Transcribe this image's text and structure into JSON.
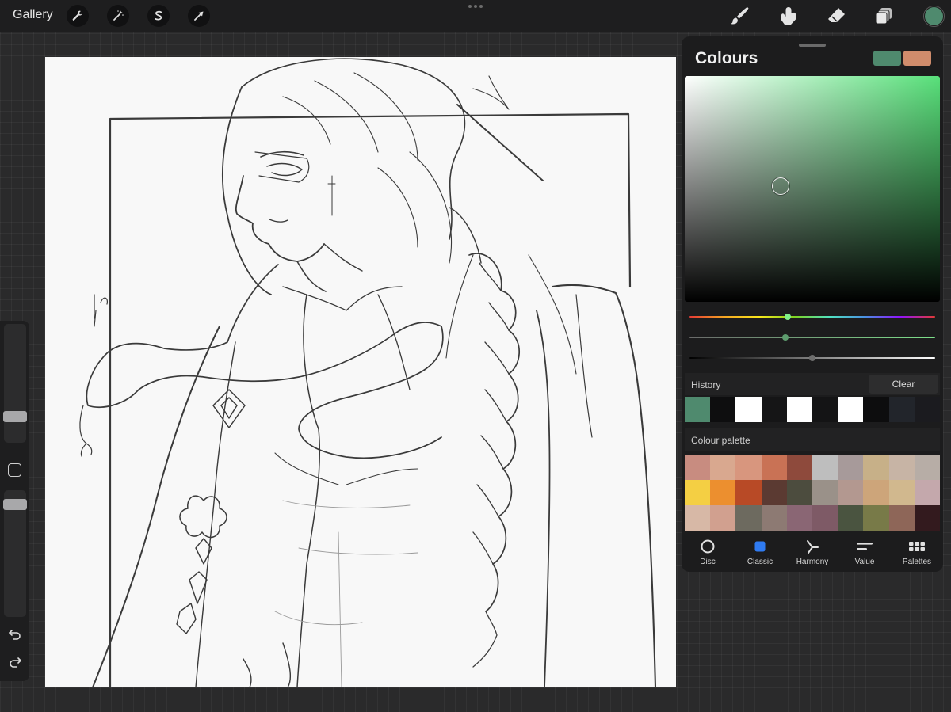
{
  "topbar": {
    "gallery_label": "Gallery",
    "left_tools": [
      "wrench-icon",
      "magic-wand-icon",
      "selection-icon",
      "transform-arrow-icon"
    ],
    "right_tools": [
      "brush-icon",
      "smudge-icon",
      "eraser-icon",
      "layers-icon"
    ],
    "current_color": "#4f8a6e"
  },
  "canvas": {
    "background": "#f8f8f8",
    "content": "line-art illustration"
  },
  "sidebar": {
    "brush_size_level": 0.25,
    "opacity_level": 0.9
  },
  "colours_panel": {
    "title": "Colours",
    "primary_swatch": "#4f8a6e",
    "secondary_swatch": "#d08c6c",
    "hue_position": 0.4,
    "saturation_position": 0.39,
    "brightness_position": 0.5,
    "history": {
      "label": "History",
      "clear_label": "Clear",
      "colors": [
        "#4f8a6e",
        "#0e0e0f",
        "#ffffff",
        "#151516",
        "#ffffff",
        "#141415",
        "#ffffff",
        "#0d0d0e",
        "#22252b",
        "#1b1b1f"
      ]
    },
    "palette": {
      "label": "Colour palette",
      "colors": [
        "#c88c80",
        "#d9a88f",
        "#d8967e",
        "#c97255",
        "#8e4a3c",
        "#bebebe",
        "#a79a9a",
        "#c7b088",
        "#c7b4a5",
        "#b7ada6",
        "#f4cf43",
        "#ec8f2f",
        "#b84a26",
        "#5b3a32",
        "#4c4c3e",
        "#9a9189",
        "#b39890",
        "#cda57a",
        "#d1b88e",
        "#c4a8ac",
        "#d7b8a6",
        "#d1a08f",
        "#6d6a5f",
        "#8d7a73",
        "#8a6674",
        "#7e5a66",
        "#4a5440",
        "#787a48",
        "#8e6658",
        "#331a1e"
      ]
    },
    "tabs": [
      {
        "label": "Disc",
        "icon": "disc-icon"
      },
      {
        "label": "Classic",
        "icon": "classic-square-icon"
      },
      {
        "label": "Harmony",
        "icon": "harmony-icon"
      },
      {
        "label": "Value",
        "icon": "value-sliders-icon"
      },
      {
        "label": "Palettes",
        "icon": "palettes-grid-icon"
      }
    ],
    "active_tab": "Classic"
  }
}
